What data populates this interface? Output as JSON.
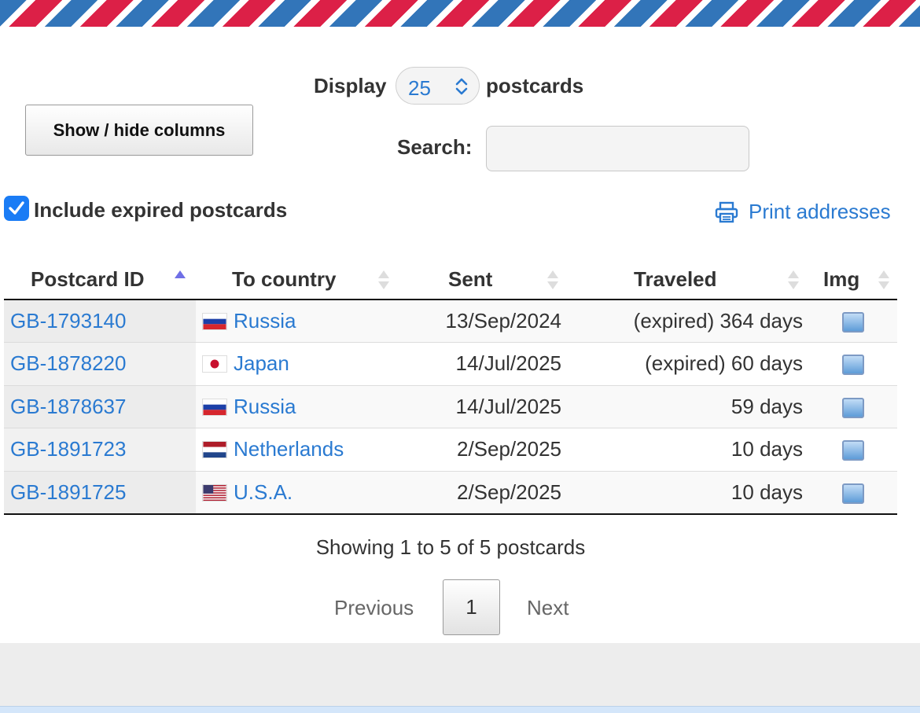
{
  "controls": {
    "display_label": "Display",
    "display_value": "25",
    "display_suffix": "postcards",
    "show_hide_label": "Show / hide columns",
    "search_label": "Search:",
    "search_value": "",
    "include_expired_label": "Include expired postcards",
    "include_expired_checked": true,
    "print_label": "Print addresses"
  },
  "table": {
    "columns": [
      "Postcard ID",
      "To country",
      "Sent",
      "Traveled",
      "Img"
    ],
    "sorted_column": "Postcard ID",
    "sort_direction": "ascending",
    "rows": [
      {
        "id": "GB-1793140",
        "country": "Russia",
        "flag": "russia-flag",
        "sent": "13/Sep/2024",
        "traveled": "(expired) 364 days"
      },
      {
        "id": "GB-1878220",
        "country": "Japan",
        "flag": "japan-flag",
        "sent": "14/Jul/2025",
        "traveled": "(expired) 60 days"
      },
      {
        "id": "GB-1878637",
        "country": "Russia",
        "flag": "russia-flag",
        "sent": "14/Jul/2025",
        "traveled": "59 days"
      },
      {
        "id": "GB-1891723",
        "country": "Netherlands",
        "flag": "netherlands-flag",
        "sent": "2/Sep/2025",
        "traveled": "10 days"
      },
      {
        "id": "GB-1891725",
        "country": "U.S.A.",
        "flag": "usa-flag",
        "sent": "2/Sep/2025",
        "traveled": "10 days"
      }
    ]
  },
  "pagination": {
    "showing": "Showing 1 to 5 of 5 postcards",
    "previous": "Previous",
    "current_page": "1",
    "next": "Next"
  },
  "colors": {
    "link": "#2a7ad1",
    "stripe_blue": "#3275b9",
    "stripe_red": "#dc2047",
    "checkbox": "#1a7cf5"
  }
}
